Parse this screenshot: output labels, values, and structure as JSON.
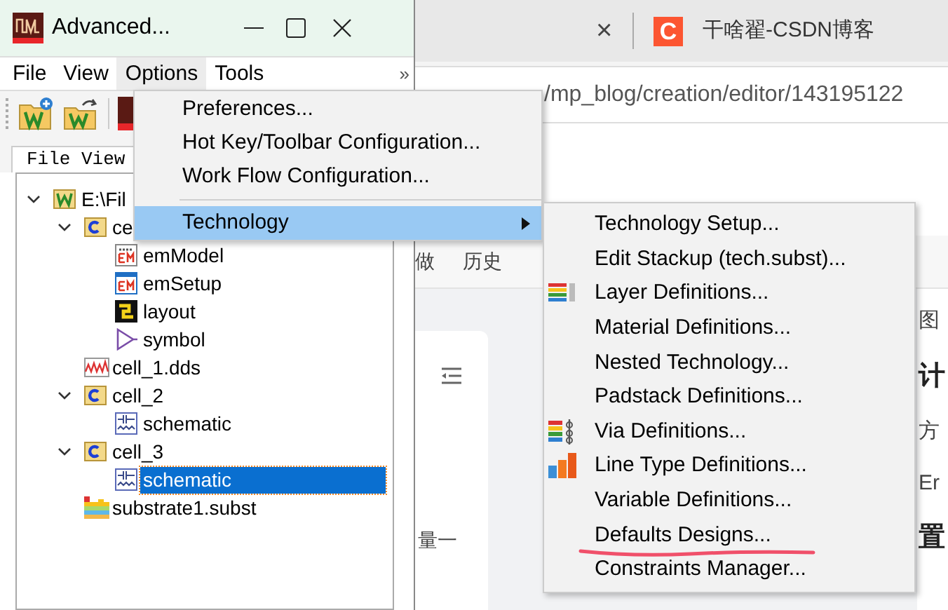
{
  "browser": {
    "tab": {
      "close": "×",
      "logo": "C",
      "title": "干啥翟-CSDN博客"
    },
    "url": "/mp_blog/creation/editor/143195122",
    "toolbar": [
      "做",
      "历史"
    ],
    "side_text": "量一",
    "content": [
      {
        "text": "图",
        "kind": "body"
      },
      {
        "text": "计",
        "kind": "heading"
      },
      {
        "text": "方",
        "kind": "body"
      },
      {
        "text": "Er",
        "kind": "body"
      },
      {
        "text": "置",
        "kind": "heading"
      }
    ]
  },
  "window": {
    "title": "Advanced...",
    "menu": [
      {
        "label": "File",
        "selected": false
      },
      {
        "label": "View",
        "selected": false
      },
      {
        "label": "Options",
        "selected": true
      },
      {
        "label": "Tools",
        "selected": false
      }
    ],
    "overflow": "»",
    "file_view_tab": "File View",
    "tree": [
      {
        "label": "E:\\Fil",
        "kind": "workspace",
        "expanded": true,
        "selected": false,
        "children": [
          {
            "label": "ce",
            "kind": "cell",
            "expanded": true,
            "selected": false,
            "children": [
              {
                "label": "emModel",
                "kind": "em-model",
                "selected": false
              },
              {
                "label": "emSetup",
                "kind": "em-setup",
                "selected": false
              },
              {
                "label": "layout",
                "kind": "layout",
                "selected": false
              },
              {
                "label": "symbol",
                "kind": "symbol",
                "selected": false
              }
            ]
          },
          {
            "label": "cell_1.dds",
            "kind": "dds",
            "selected": false
          },
          {
            "label": "cell_2",
            "kind": "cell",
            "expanded": true,
            "selected": false,
            "children": [
              {
                "label": "schematic",
                "kind": "schematic",
                "selected": false
              }
            ]
          },
          {
            "label": "cell_3",
            "kind": "cell",
            "expanded": true,
            "selected": false,
            "children": [
              {
                "label": "schematic",
                "kind": "schematic",
                "selected": true
              }
            ]
          },
          {
            "label": "substrate1.subst",
            "kind": "substrate",
            "selected": false
          }
        ]
      }
    ]
  },
  "options_menu": [
    {
      "kind": "item",
      "label": "Preferences...",
      "selected": false
    },
    {
      "kind": "item",
      "label": "Hot Key/Toolbar Configuration...",
      "selected": false
    },
    {
      "kind": "item",
      "label": "Work Flow Configuration...",
      "selected": false
    },
    {
      "kind": "separator"
    },
    {
      "kind": "submenu",
      "label": "Technology",
      "selected": true
    }
  ],
  "technology_menu": [
    {
      "label": "Technology Setup...",
      "kind": "plain",
      "underlined": false
    },
    {
      "label": "Edit Stackup (tech.subst)...",
      "kind": "plain",
      "underlined": false
    },
    {
      "label": "Layer Definitions...",
      "kind": "layer",
      "underlined": false
    },
    {
      "label": "Material Definitions...",
      "kind": "plain",
      "underlined": false
    },
    {
      "label": "Nested Technology...",
      "kind": "plain",
      "underlined": false
    },
    {
      "label": "Padstack Definitions...",
      "kind": "plain",
      "underlined": false
    },
    {
      "label": "Via Definitions...",
      "kind": "via",
      "underlined": false
    },
    {
      "label": "Line Type Definitions...",
      "kind": "line-type",
      "underlined": false
    },
    {
      "label": "Variable Definitions...",
      "kind": "plain",
      "underlined": false
    },
    {
      "label": "Defaults Designs...",
      "kind": "plain",
      "underlined": true
    },
    {
      "label": "Constraints Manager...",
      "kind": "plain",
      "underlined": false
    }
  ]
}
